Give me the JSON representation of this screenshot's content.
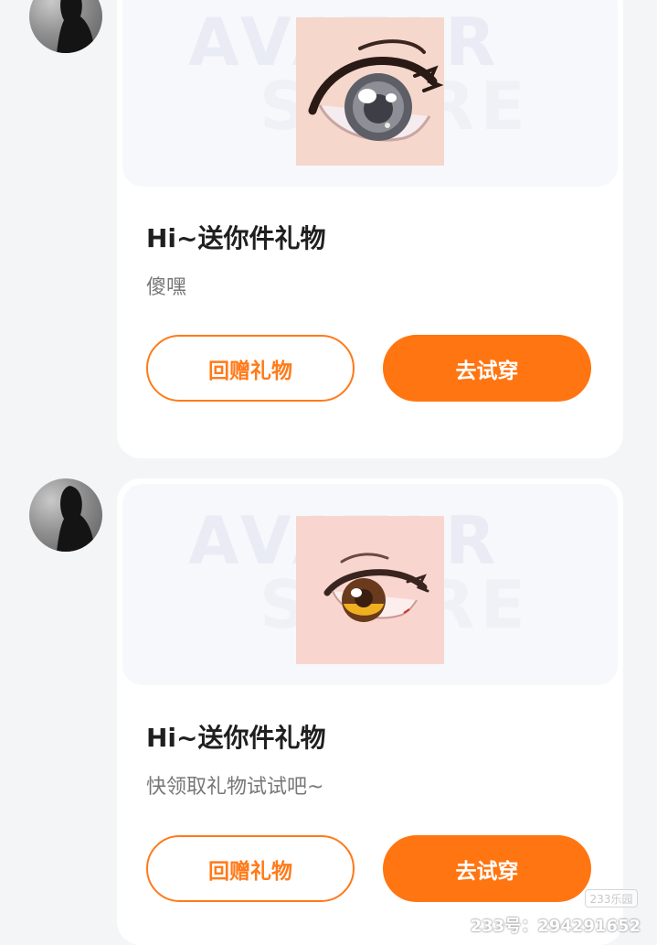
{
  "colors": {
    "accent": "#ff7511",
    "card_bg": "#ffffff",
    "page_bg": "#f4f5f7"
  },
  "messages": [
    {
      "title": "Hi~送你件礼物",
      "subtitle": "傻嘿",
      "watermark_top": "AVATAR",
      "watermark_bottom": "STORE",
      "return_gift_label": "回赠礼物",
      "try_on_label": "去试穿",
      "eye_style": "gray-eye"
    },
    {
      "title": "Hi~送你件礼物",
      "subtitle": "快领取礼物试试吧~",
      "watermark_top": "AVATAR",
      "watermark_bottom": "STORE",
      "return_gift_label": "回赠礼物",
      "try_on_label": "去试穿",
      "eye_style": "amber-eye"
    }
  ],
  "overlay": {
    "brand_tag": "233乐园",
    "id_text": "233号：294291652"
  }
}
